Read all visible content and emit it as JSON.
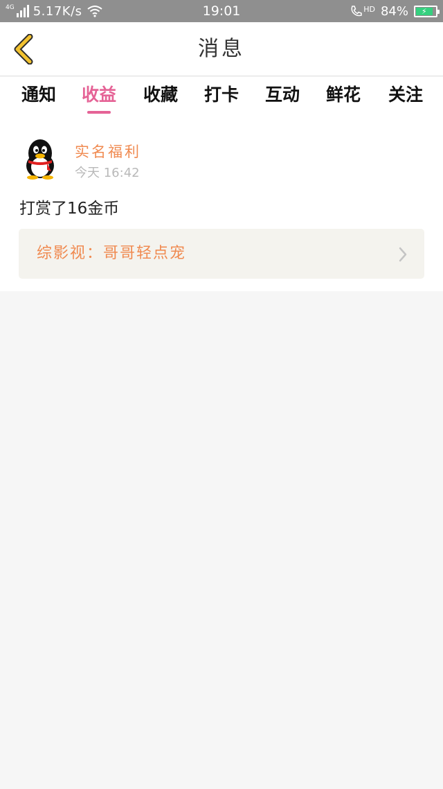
{
  "status_bar": {
    "network": "4G",
    "speed": "5.17K/s",
    "time": "19:01",
    "hd": "HD",
    "battery_percent": "84%",
    "battery_level": 0.84,
    "icons": [
      "signal-icon",
      "wifi-icon",
      "call-hd-icon",
      "battery-charging-icon"
    ]
  },
  "header": {
    "title": "消息",
    "back_icon": "chevron-left-icon",
    "back_color": "#f2c230"
  },
  "tabs": {
    "items": [
      {
        "label": "通知"
      },
      {
        "label": "收益"
      },
      {
        "label": "收藏"
      },
      {
        "label": "打卡"
      },
      {
        "label": "互动"
      },
      {
        "label": "鲜花"
      },
      {
        "label": "关注"
      }
    ],
    "active_index": 1,
    "active_color": "#e56396"
  },
  "message": {
    "avatar_icon": "qq-penguin-icon",
    "sender": "实名福利",
    "time": "今天 16:42",
    "text": "打赏了16金币",
    "link_text": "综影视：哥哥轻点宠",
    "link_icon": "chevron-right-icon",
    "accent_color": "#f08a50"
  }
}
